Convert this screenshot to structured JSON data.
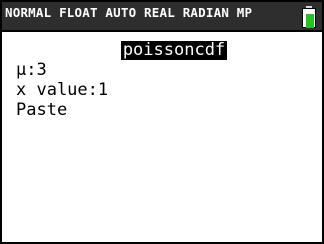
{
  "status_bar": {
    "text": "NORMAL FLOAT AUTO REAL RADIAN MP",
    "battery": {
      "icon": "battery-icon",
      "color": "#27c127"
    }
  },
  "title": "poissoncdf",
  "fields": [
    {
      "label": "μ:",
      "value": "3"
    },
    {
      "label": "x value:",
      "value": "1"
    }
  ],
  "paste_label": "Paste",
  "colors": {
    "status_bg": "#2e2e2e",
    "screen_bg": "#ffffff",
    "highlight_bg": "#000000"
  }
}
